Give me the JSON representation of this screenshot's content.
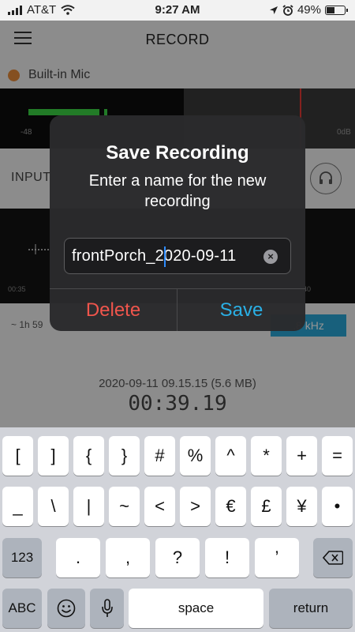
{
  "status_bar": {
    "carrier": "AT&T",
    "time": "9:27 AM",
    "battery_percent": "49%",
    "battery_level": 0.49,
    "icons": [
      "signal-icon",
      "wifi-icon",
      "location-icon",
      "alarm-icon",
      "battery-icon"
    ]
  },
  "nav": {
    "title": "RECORD",
    "menu_icon": "hamburger-icon"
  },
  "input_source": {
    "label": "Built-in Mic",
    "dot_color": "#e58b3a"
  },
  "meter": {
    "left_label": "-48",
    "right_label": "0dB"
  },
  "input_section": {
    "label": "INPUT",
    "icon": "headphones-icon"
  },
  "waveform": {
    "left_time": "00:35",
    "right_time": "40"
  },
  "info": {
    "remaining": "~ 1h 59",
    "sample_rate": "48 kHz",
    "sample_rate_visible": ".8 kHz"
  },
  "recording": {
    "file_info": "2020-09-11 09.15.15 (5.6 MB)",
    "elapsed": "00:39.19"
  },
  "dialog": {
    "title": "Save Recording",
    "message": "Enter a name for the new recording",
    "input_value": "frontPorch_2020-09-11",
    "clear_icon": "clear-icon",
    "delete_label": "Delete",
    "save_label": "Save",
    "colors": {
      "delete": "#f0554c",
      "save": "#2ab0e6"
    }
  },
  "keyboard": {
    "row1": [
      "[",
      "]",
      "{",
      "}",
      "#",
      "%",
      "^",
      "*",
      "+",
      "="
    ],
    "row2": [
      "_",
      "\\",
      "|",
      "~",
      "<",
      ">",
      "€",
      "£",
      "¥",
      "•"
    ],
    "row3_left": "123",
    "row3": [
      ".",
      ",",
      "?",
      "!",
      "’"
    ],
    "backspace_icon": "backspace-icon",
    "row4_left": "ABC",
    "emoji_icon": "emoji-icon",
    "mic_icon": "microphone-icon",
    "space": "space",
    "return": "return"
  }
}
